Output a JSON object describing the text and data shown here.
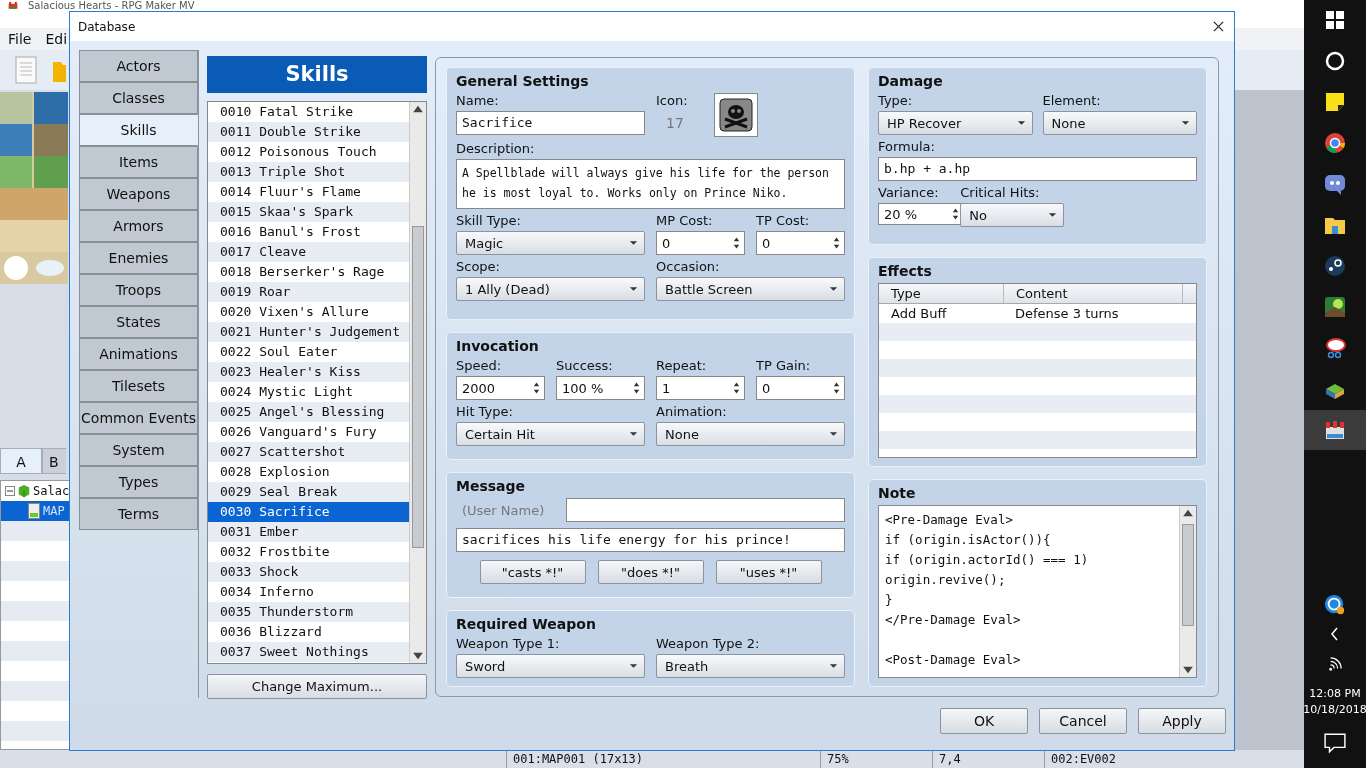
{
  "app": {
    "title": "Salacious Hearts - RPG Maker MV",
    "menu": [
      "File",
      "Edi"
    ],
    "tabs": [
      {
        "label": "A",
        "selected": true
      },
      {
        "label": "B",
        "selected": false
      }
    ],
    "tree": [
      {
        "label": "Salac",
        "expanded": true,
        "selected": false,
        "children": [
          {
            "label": "MAP",
            "selected": true
          }
        ]
      }
    ],
    "status_bar": [
      "001:MAP001 (17x13)",
      "75%",
      "7,4",
      "002:EV002"
    ]
  },
  "dialog": {
    "title": "Database",
    "categories": [
      {
        "label": "Actors",
        "selected": false
      },
      {
        "label": "Classes",
        "selected": false
      },
      {
        "label": "Skills",
        "selected": true
      },
      {
        "label": "Items",
        "selected": false
      },
      {
        "label": "Weapons",
        "selected": false
      },
      {
        "label": "Armors",
        "selected": false
      },
      {
        "label": "Enemies",
        "selected": false
      },
      {
        "label": "Troops",
        "selected": false
      },
      {
        "label": "States",
        "selected": false
      },
      {
        "label": "Animations",
        "selected": false
      },
      {
        "label": "Tilesets",
        "selected": false
      },
      {
        "label": "Common Events",
        "selected": false
      },
      {
        "label": "System",
        "selected": false
      },
      {
        "label": "Types",
        "selected": false
      },
      {
        "label": "Terms",
        "selected": false
      }
    ],
    "list": {
      "title": "Skills",
      "button": "Change Maximum...",
      "items": [
        {
          "label": "0010 Fatal Strike",
          "selected": false
        },
        {
          "label": "0011 Double Strike",
          "selected": false
        },
        {
          "label": "0012 Poisonous Touch",
          "selected": false
        },
        {
          "label": "0013 Triple Shot",
          "selected": false
        },
        {
          "label": "0014 Fluur's Flame",
          "selected": false
        },
        {
          "label": "0015 Skaa's Spark",
          "selected": false
        },
        {
          "label": "0016 Banul's Frost",
          "selected": false
        },
        {
          "label": "0017 Cleave",
          "selected": false
        },
        {
          "label": "0018 Berserker's Rage",
          "selected": false
        },
        {
          "label": "0019 Roar",
          "selected": false
        },
        {
          "label": "0020 Vixen's Allure",
          "selected": false
        },
        {
          "label": "0021 Hunter's Judgement",
          "selected": false
        },
        {
          "label": "0022 Soul Eater",
          "selected": false
        },
        {
          "label": "0023 Healer's Kiss",
          "selected": false
        },
        {
          "label": "0024 Mystic Light",
          "selected": false
        },
        {
          "label": "0025 Angel's Blessing",
          "selected": false
        },
        {
          "label": "0026 Vanguard's Fury",
          "selected": false
        },
        {
          "label": "0027 Scattershot",
          "selected": false
        },
        {
          "label": "0028 Explosion",
          "selected": false
        },
        {
          "label": "0029 Seal Break",
          "selected": false
        },
        {
          "label": "0030 Sacrifice",
          "selected": true
        },
        {
          "label": "0031 Ember",
          "selected": false
        },
        {
          "label": "0032 Frostbite",
          "selected": false
        },
        {
          "label": "0033 Shock",
          "selected": false
        },
        {
          "label": "0034 Inferno",
          "selected": false
        },
        {
          "label": "0035 Thunderstorm",
          "selected": false
        },
        {
          "label": "0036 Blizzard",
          "selected": false
        },
        {
          "label": "0037 Sweet Nothings",
          "selected": false
        }
      ]
    },
    "panels": [
      {
        "title": "General Settings",
        "fields": [
          {
            "kind": "text",
            "label": "Name:",
            "value": "Sacrifice"
          },
          {
            "kind": "icon",
            "label": "Icon:",
            "value": "17"
          },
          {
            "kind": "memo",
            "label": "Description:",
            "value": "A Spellblade will always give his life for the person he is most loyal to. Works only on Prince Niko."
          },
          {
            "kind": "select",
            "label": "Skill Type:",
            "value": "Magic"
          },
          {
            "kind": "spin",
            "label": "MP Cost:",
            "value": "0"
          },
          {
            "kind": "spin",
            "label": "TP Cost:",
            "value": "0"
          },
          {
            "kind": "select",
            "label": "Scope:",
            "value": "1 Ally (Dead)"
          },
          {
            "kind": "select",
            "label": "Occasion:",
            "value": "Battle Screen"
          }
        ]
      },
      {
        "title": "Invocation",
        "fields": [
          {
            "kind": "spin",
            "label": "Speed:",
            "value": "2000"
          },
          {
            "kind": "spin",
            "label": "Success:",
            "value": "100 %"
          },
          {
            "kind": "spin",
            "label": "Repeat:",
            "value": "1"
          },
          {
            "kind": "spin",
            "label": "TP Gain:",
            "value": "0"
          },
          {
            "kind": "select",
            "label": "Hit Type:",
            "value": "Certain Hit"
          },
          {
            "kind": "select",
            "label": "Animation:",
            "value": "None"
          }
        ]
      }
    ],
    "message": {
      "title": "Message",
      "user_label": "(User Name)",
      "line": "sacrifices his life energy for his prince!",
      "buttons": [
        "\"casts *!\"",
        "\"does *!\"",
        "\"uses *!\""
      ]
    },
    "weapon": {
      "title": "Required Weapon",
      "fields": [
        {
          "kind": "select",
          "label": "Weapon Type 1:",
          "value": "Sword"
        },
        {
          "kind": "select",
          "label": "Weapon Type 2:",
          "value": "Breath"
        }
      ]
    },
    "damage": {
      "title": "Damage",
      "fields": [
        {
          "kind": "select",
          "label": "Type:",
          "value": "HP Recover"
        },
        {
          "kind": "select",
          "label": "Element:",
          "value": "None"
        },
        {
          "kind": "line",
          "label": "Formula:",
          "value": "b.hp + a.hp"
        },
        {
          "kind": "spin",
          "label": "Variance:",
          "value": "20 %"
        },
        {
          "kind": "select",
          "label": "Critical Hits:",
          "value": "No"
        }
      ]
    },
    "effects": {
      "title": "Effects",
      "columns": [
        "Type",
        "Content"
      ],
      "rows": [
        [
          "Add Buff",
          "Defense 3 turns"
        ]
      ]
    },
    "note": {
      "title": "Note",
      "blocks": [
        [
          "<Pre-Damage Eval>",
          "if (origin.isActor()){",
          "if (origin.actorId() === 1)",
          "origin.revive();",
          "}",
          "</Pre-Damage Eval>"
        ],
        [
          "<Post-Damage Eval>"
        ]
      ]
    },
    "buttons": [
      "OK",
      "Cancel",
      "Apply"
    ]
  },
  "taskbar": {
    "apps": [
      {
        "kind": "start",
        "selected": false
      },
      {
        "kind": "search",
        "selected": false
      },
      {
        "kind": "note",
        "selected": false
      },
      {
        "kind": "browser",
        "selected": false
      },
      {
        "kind": "chat",
        "selected": false
      },
      {
        "kind": "folder",
        "selected": false
      },
      {
        "kind": "disc",
        "selected": false
      },
      {
        "kind": "landscape",
        "selected": false
      },
      {
        "kind": "scissors",
        "selected": false
      },
      {
        "kind": "cube",
        "selected": false
      },
      {
        "kind": "castle",
        "selected": true
      }
    ],
    "time": "12:08 PM",
    "date": "10/18/2018"
  }
}
